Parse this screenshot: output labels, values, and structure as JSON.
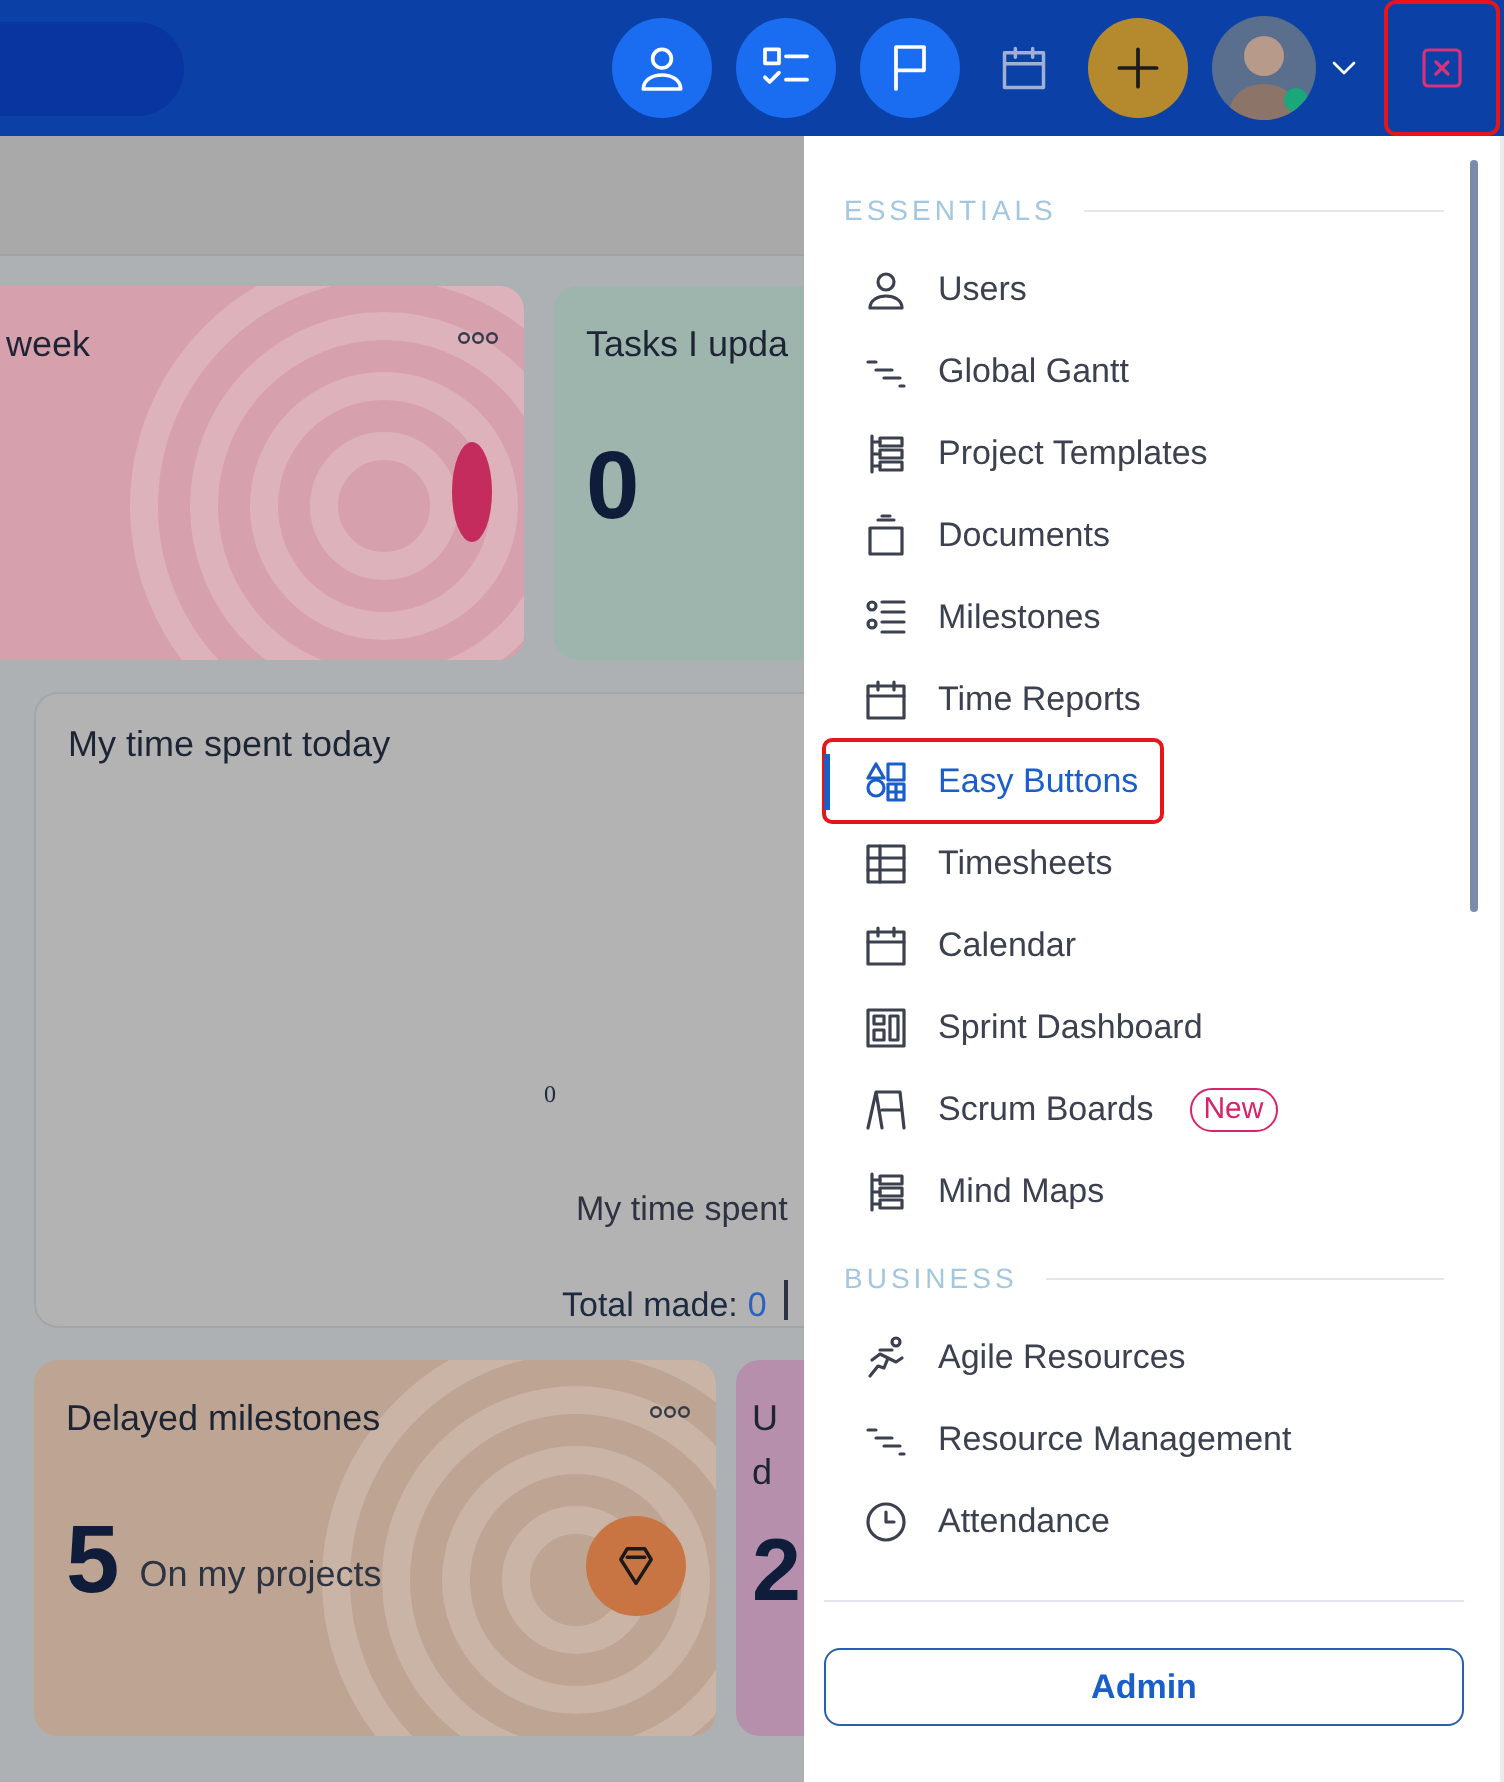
{
  "top_bar": {
    "actions": [
      {
        "kind": "user"
      },
      {
        "kind": "tasks"
      },
      {
        "kind": "flag"
      },
      {
        "kind": "calendar"
      },
      {
        "kind": "add"
      },
      {
        "kind": "avatar"
      },
      {
        "kind": "chevron"
      },
      {
        "kind": "close",
        "highlighted": true
      }
    ]
  },
  "dashboard": {
    "cards": [
      {
        "kind": "stat",
        "title": "week",
        "color": "#d6a1ad"
      },
      {
        "kind": "stat",
        "title": "Tasks I upda",
        "value": "0",
        "color": "#9db5ac"
      },
      {
        "kind": "chart",
        "title": "My time spent today",
        "axis_label": "0",
        "legend": "My time spent",
        "total_label": "Total made:",
        "total_value": "0"
      },
      {
        "kind": "stat",
        "title": "Delayed milestones",
        "value": "5",
        "caption": "On my projects",
        "color": "#bda493"
      },
      {
        "kind": "stat",
        "title_lines": [
          "U",
          "d"
        ],
        "value": "2",
        "color": "#b58fab"
      }
    ]
  },
  "menu": {
    "sections": [
      {
        "title": "ESSENTIALS",
        "items": [
          {
            "label": "Users",
            "selected": false
          },
          {
            "label": "Global Gantt",
            "selected": false
          },
          {
            "label": "Project Templates",
            "selected": false
          },
          {
            "label": "Documents",
            "selected": false
          },
          {
            "label": "Milestones",
            "selected": false
          },
          {
            "label": "Time Reports",
            "selected": false
          },
          {
            "label": "Easy Buttons",
            "selected": true,
            "highlighted": true
          },
          {
            "label": "Timesheets",
            "selected": false
          },
          {
            "label": "Calendar",
            "selected": false
          },
          {
            "label": "Sprint Dashboard",
            "selected": false
          },
          {
            "label": "Scrum Boards",
            "selected": false,
            "tag": "New"
          },
          {
            "label": "Mind Maps",
            "selected": false
          }
        ]
      },
      {
        "title": "BUSINESS",
        "items": [
          {
            "label": "Agile Resources",
            "selected": false
          },
          {
            "label": "Resource Management",
            "selected": false
          },
          {
            "label": "Attendance",
            "selected": false
          }
        ]
      }
    ],
    "footer_button": "Admin"
  }
}
